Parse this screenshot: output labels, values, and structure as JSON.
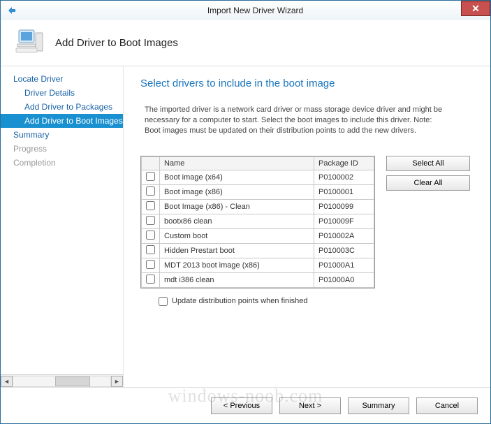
{
  "window": {
    "title": "Import New Driver Wizard"
  },
  "header": {
    "title": "Add Driver to Boot Images"
  },
  "sidebar": {
    "items": [
      {
        "label": "Locate Driver",
        "kind": "top"
      },
      {
        "label": "Driver Details",
        "kind": "sub"
      },
      {
        "label": "Add Driver to Packages",
        "kind": "sub"
      },
      {
        "label": "Add Driver to Boot Images",
        "kind": "sub",
        "active": true
      },
      {
        "label": "Summary",
        "kind": "top"
      },
      {
        "label": "Progress",
        "kind": "dim"
      },
      {
        "label": "Completion",
        "kind": "dim"
      }
    ]
  },
  "content": {
    "heading": "Select drivers to include in the boot image",
    "description": "The imported driver is a network card driver or mass storage device driver and might be necessary for a computer to start. Select the boot images to include this driver.  Note: Boot images must be updated on their distribution points to add the new drivers.",
    "columns": {
      "name": "Name",
      "pkg": "Package ID"
    },
    "rows": [
      {
        "name": "Boot image (x64)",
        "pkg": "P0100002"
      },
      {
        "name": "Boot image (x86)",
        "pkg": "P0100001"
      },
      {
        "name": "Boot Image (x86) - Clean",
        "pkg": "P0100099"
      },
      {
        "name": "bootx86 clean",
        "pkg": "P010009F"
      },
      {
        "name": "Custom boot",
        "pkg": "P010002A"
      },
      {
        "name": "Hidden Prestart boot",
        "pkg": "P010003C"
      },
      {
        "name": "MDT 2013 boot image (x86)",
        "pkg": "P01000A1"
      },
      {
        "name": "mdt i386 clean",
        "pkg": "P01000A0"
      }
    ],
    "select_all": "Select All",
    "clear_all": "Clear All",
    "update_label": "Update distribution points when finished"
  },
  "footer": {
    "previous": "< Previous",
    "next": "Next >",
    "summary": "Summary",
    "cancel": "Cancel"
  },
  "watermark": "windows-noob.com"
}
